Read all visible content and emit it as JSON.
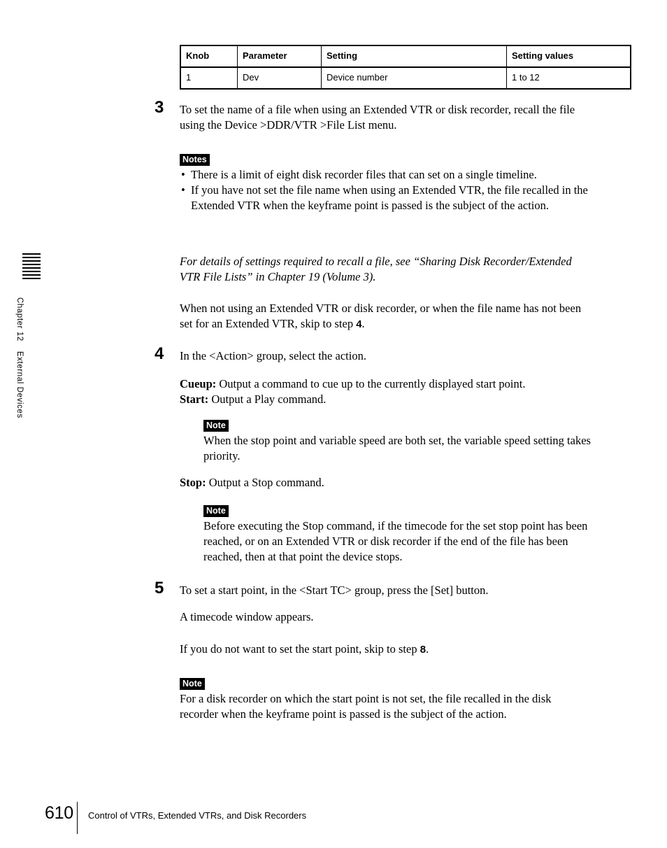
{
  "chapter_tab": {
    "chapter": "Chapter 12",
    "section": "External Devices",
    "stripe_count": 8
  },
  "table": {
    "headers": [
      "Knob",
      "Parameter",
      "Setting",
      "Setting values"
    ],
    "rows": [
      [
        "1",
        "Dev",
        "Device number",
        "1 to 12"
      ]
    ]
  },
  "steps": {
    "step3": {
      "number": "3",
      "text": "To set the name of a file when using an Extended VTR or disk recorder, recall the file using the Device >DDR/VTR >File List menu."
    },
    "step4": {
      "number": "4",
      "text": "In the <Action> group, select the action."
    },
    "step5": {
      "number": "5",
      "text": "To set a start point, in the <Start TC> group, press the [Set] button."
    }
  },
  "notes_block_1": {
    "badge": "Notes",
    "items": [
      "There is a limit of eight disk recorder files that can set on a single timeline.",
      "If you have not set the file name when using an Extended VTR, the file recalled in the Extended VTR when the keyframe point is passed is the subject of the action."
    ]
  },
  "reference": {
    "text": "For details of settings required to recall a file, see “Sharing Disk Recorder/Extended VTR File Lists” in Chapter 19 (Volume 3)."
  },
  "paragraph_skip_to_4": {
    "before": "When not using an Extended VTR or disk recorder, or when  the file name has not been set for an Extended VTR, skip to step ",
    "step_ref": "4",
    "after": "."
  },
  "actions": {
    "cueup_label": "Cueup:",
    "cueup_text": " Output a command to cue up to the currently displayed start point.",
    "start_label": "Start:",
    "start_text": " Output a Play command.",
    "stop_label": "Stop:",
    "stop_text": " Output a Stop command."
  },
  "note_variable_speed": {
    "badge": "Note",
    "text": "When the stop point and variable speed are both set, the variable speed setting takes priority."
  },
  "note_stop_command": {
    "badge": "Note",
    "text": "Before executing the Stop command, if the timecode for the set stop point has been reached, or on an Extended VTR or disk recorder if the end of the file has been reached, then at that point the device stops."
  },
  "paragraph_timecode_window": {
    "text": "A timecode window appears."
  },
  "paragraph_skip_to_8": {
    "before": "If you do not want to set the start point, skip to step ",
    "step_ref": "8",
    "after": "."
  },
  "note_start_point": {
    "badge": "Note",
    "text": "For a disk recorder on which the start point is not set, the file recalled in the disk recorder when the keyframe point is passed is the subject of the action."
  },
  "footer": {
    "page_number": "610",
    "title": "Control of VTRs, Extended VTRs, and Disk Recorders"
  },
  "colors": {
    "text": "#000000",
    "background": "#ffffff",
    "badge_bg": "#000000",
    "badge_fg": "#ffffff"
  }
}
